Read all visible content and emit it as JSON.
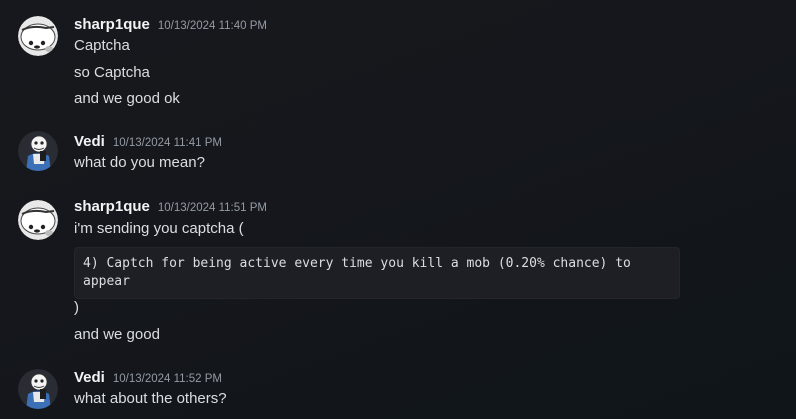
{
  "messages": [
    {
      "author": "sharp1que",
      "timestamp": "10/13/2024 11:40 PM",
      "avatar_icon": "white-creature-icon",
      "lines": [
        "Captcha",
        "so Captcha",
        "and we good ok"
      ]
    },
    {
      "author": "Vedi",
      "timestamp": "10/13/2024 11:41 PM",
      "avatar_icon": "skeleton-character-icon",
      "lines": [
        "what do you mean?"
      ]
    },
    {
      "author": "sharp1que",
      "timestamp": "10/13/2024 11:51 PM",
      "avatar_icon": "white-creature-icon",
      "lines": [
        "i'm sending you captcha ("
      ],
      "code": "4) Captch for being active every time you kill a mob (0.20% chance) to appear",
      "after_lines": [
        ")",
        "and we good"
      ]
    },
    {
      "author": "Vedi",
      "timestamp": "10/13/2024 11:52 PM",
      "avatar_icon": "skeleton-character-icon",
      "lines": [
        "what about the others?"
      ]
    }
  ],
  "colors": {
    "background": "#16171c",
    "username": "#f2f3f5",
    "timestamp": "#949ba4",
    "text": "#dbdee1",
    "code_background": "#1e1f24"
  }
}
